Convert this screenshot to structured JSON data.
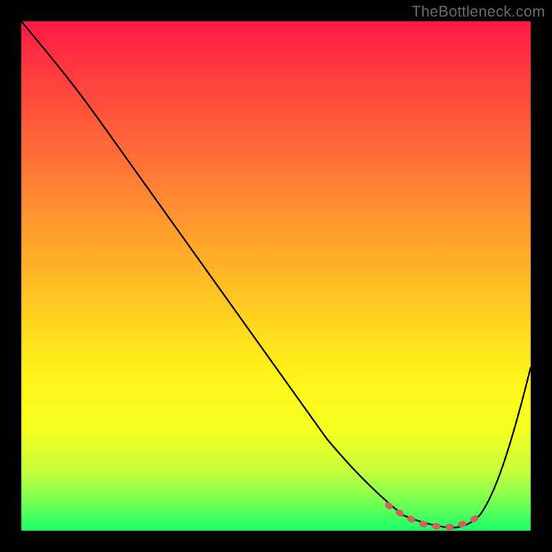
{
  "watermark": "TheBottleneck.com",
  "chart_data": {
    "type": "line",
    "title": "",
    "xlabel": "",
    "ylabel": "",
    "xlim": [
      0,
      100
    ],
    "ylim": [
      0,
      100
    ],
    "grid": false,
    "legend": false,
    "series": [
      {
        "name": "curve",
        "color": "#000000",
        "x": [
          0,
          5,
          10,
          15,
          20,
          25,
          30,
          35,
          40,
          45,
          50,
          55,
          60,
          65,
          70,
          75,
          80,
          82,
          85,
          88,
          90,
          95,
          100
        ],
        "y": [
          100,
          94,
          88,
          81,
          74,
          67,
          60,
          53,
          46,
          39,
          32,
          25,
          18,
          12,
          7,
          3,
          1,
          0.5,
          0.5,
          1,
          3,
          13,
          32
        ]
      },
      {
        "name": "highlight",
        "color": "#d26060",
        "style": "dashed-thick",
        "x": [
          72,
          74,
          76,
          78,
          80,
          82,
          84,
          86,
          88,
          90
        ],
        "y": [
          5,
          3.5,
          2.5,
          1.5,
          1,
          0.7,
          0.7,
          1,
          1.5,
          3
        ]
      }
    ]
  }
}
